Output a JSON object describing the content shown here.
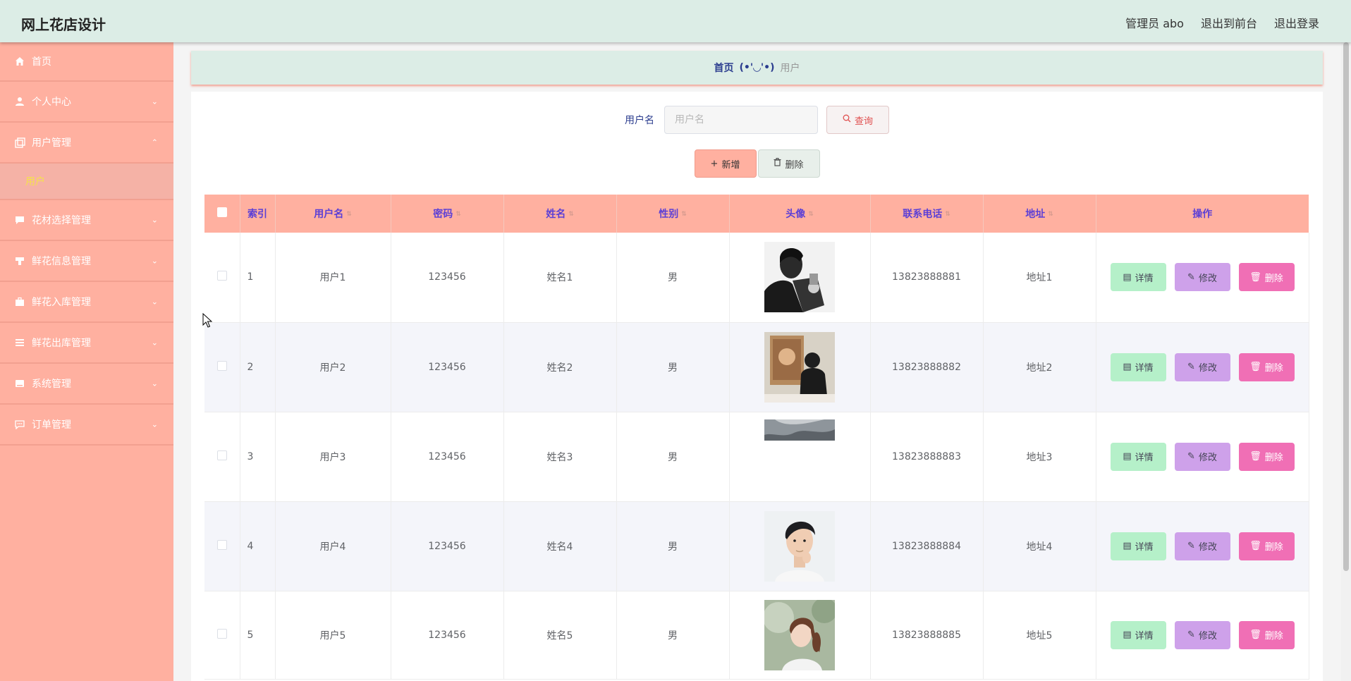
{
  "app": {
    "title": "网上花店设计"
  },
  "topbar": {
    "user": "管理员 abo",
    "to_front": "退出到前台",
    "logout": "退出登录"
  },
  "sidebar": {
    "items": [
      {
        "label": "首页",
        "icon": "home-icon"
      },
      {
        "label": "个人中心",
        "icon": "user-icon"
      },
      {
        "label": "用户管理",
        "icon": "copy-icon",
        "expanded": true,
        "children": [
          "用户"
        ]
      },
      {
        "label": "花材选择管理",
        "icon": "chat-icon"
      },
      {
        "label": "鲜花信息管理",
        "icon": "stamp-icon"
      },
      {
        "label": "鲜花入库管理",
        "icon": "briefcase-icon"
      },
      {
        "label": "鲜花出库管理",
        "icon": "list-icon"
      },
      {
        "label": "系统管理",
        "icon": "disk-icon"
      },
      {
        "label": "订单管理",
        "icon": "message-icon"
      }
    ]
  },
  "breadcrumb": {
    "home": "首页",
    "separator": "(•'◡'•)",
    "current": "用户"
  },
  "search": {
    "label": "用户名",
    "placeholder": "用户名",
    "value": "",
    "button": "查询"
  },
  "actions": {
    "add": "新增",
    "delete": "删除"
  },
  "table": {
    "columns": [
      "索引",
      "用户名",
      "密码",
      "姓名",
      "性别",
      "头像",
      "联系电话",
      "地址",
      "操作"
    ],
    "rows": [
      {
        "index": "1",
        "username": "用户1",
        "password": "123456",
        "name": "姓名1",
        "gender": "男",
        "phone": "13823888881",
        "address": "地址1"
      },
      {
        "index": "2",
        "username": "用户2",
        "password": "123456",
        "name": "姓名2",
        "gender": "男",
        "phone": "13823888882",
        "address": "地址2"
      },
      {
        "index": "3",
        "username": "用户3",
        "password": "123456",
        "name": "姓名3",
        "gender": "男",
        "phone": "13823888883",
        "address": "地址3"
      },
      {
        "index": "4",
        "username": "用户4",
        "password": "123456",
        "name": "姓名4",
        "gender": "男",
        "phone": "13823888884",
        "address": "地址4"
      },
      {
        "index": "5",
        "username": "用户5",
        "password": "123456",
        "name": "姓名5",
        "gender": "男",
        "phone": "13823888885",
        "address": "地址5"
      }
    ],
    "row_actions": {
      "detail": "详情",
      "edit": "修改",
      "delete": "删除"
    }
  },
  "colors": {
    "topbar": "#dcede6",
    "sidebar": "#ffb0a0",
    "header": "#ffb0a0",
    "header_text": "#5b3fd6",
    "submenu_active": "#f5e24a",
    "detail_btn": "#b5f0c9",
    "edit_btn": "#cea1ea",
    "delete_btn": "#f06fb5"
  }
}
